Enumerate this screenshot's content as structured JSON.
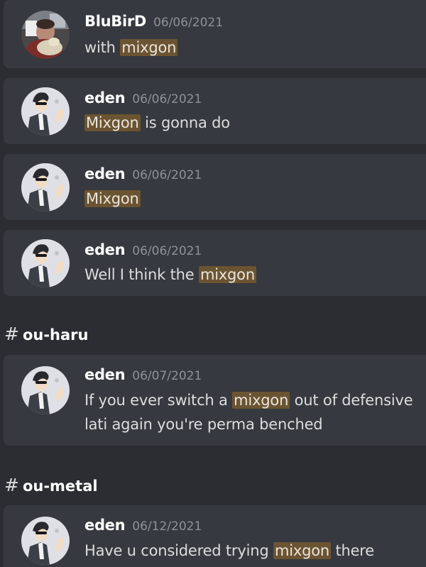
{
  "results": [
    {
      "username": "BluBirD",
      "timestamp": "06/06/2021",
      "avatar": "blubird-avatar",
      "parts": [
        {
          "text": "with ",
          "highlight": false
        },
        {
          "text": "mixgon",
          "highlight": true
        }
      ]
    },
    {
      "username": "eden",
      "timestamp": "06/06/2021",
      "avatar": "eden-avatar",
      "parts": [
        {
          "text": "Mixgon",
          "highlight": true
        },
        {
          "text": " is gonna do",
          "highlight": false
        }
      ]
    },
    {
      "username": "eden",
      "timestamp": "06/06/2021",
      "avatar": "eden-avatar",
      "parts": [
        {
          "text": "Mixgon",
          "highlight": true
        }
      ]
    },
    {
      "username": "eden",
      "timestamp": "06/06/2021",
      "avatar": "eden-avatar",
      "parts": [
        {
          "text": "Well I think the ",
          "highlight": false
        },
        {
          "text": "mixgon",
          "highlight": true
        }
      ]
    },
    {
      "username": "eden",
      "timestamp": "06/07/2021",
      "avatar": "eden-avatar",
      "parts": [
        {
          "text": "If you ever switch a ",
          "highlight": false
        },
        {
          "text": "mixgon",
          "highlight": true
        },
        {
          "text": " out of defensive lati again you're perma benched",
          "highlight": false
        }
      ]
    },
    {
      "username": "eden",
      "timestamp": "06/12/2021",
      "avatar": "eden-avatar",
      "parts": [
        {
          "text": "Have u considered trying ",
          "highlight": false
        },
        {
          "text": "mixgon",
          "highlight": true
        },
        {
          "text": " there",
          "highlight": false
        }
      ]
    }
  ],
  "channels": [
    {
      "hash": "#",
      "name": "ou-haru"
    },
    {
      "hash": "#",
      "name": "ou-metal"
    }
  ],
  "colors": {
    "background": "#2b2d32",
    "card": "#36393f",
    "highlight": "#6b5432",
    "username": "#ffffff",
    "timestamp": "#8e9297",
    "message": "#dcddde"
  }
}
